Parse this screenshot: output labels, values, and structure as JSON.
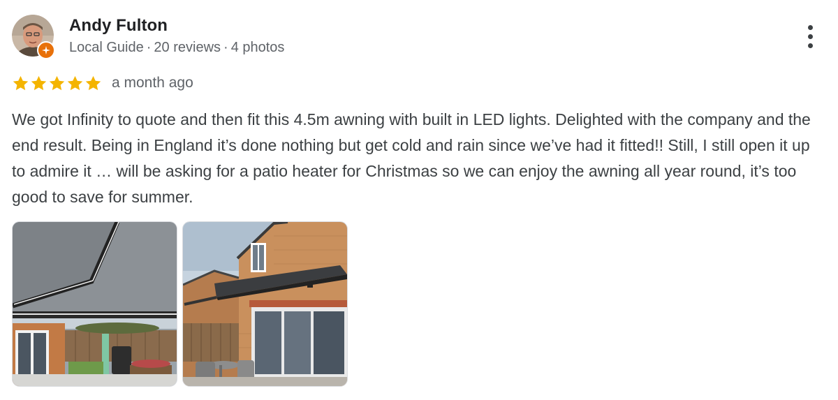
{
  "review": {
    "author": {
      "name": "Andy Fulton",
      "badge": "Local Guide",
      "reviews": "20 reviews",
      "photos": "4 photos",
      "separator": "·"
    },
    "rating": {
      "stars": 5,
      "max": 5,
      "color": "#f4b400"
    },
    "time": "a month ago",
    "text": "We got Infinity to quote and then fit this 4.5m awning with built in LED lights. Delighted with the company and the end result. Being in England it’s done nothing but get cold and rain since we’ve had it fitted!! Still, I still open it up to admire it … will be asking for a patio heater for Christmas so we can enjoy the awning all year round, it’s too good to save for summer.",
    "more_icon": "more-vert-icon",
    "photo_count_shown": 2
  },
  "colors": {
    "name": "#202124",
    "secondary": "#5f6368",
    "body": "#3c4043",
    "guide_badge": "#e8710a"
  }
}
